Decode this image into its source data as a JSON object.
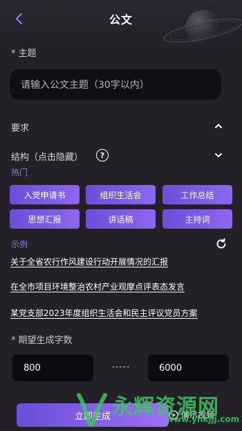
{
  "header": {
    "title": "公文"
  },
  "subject": {
    "label": "主题",
    "required_mark": "*",
    "placeholder": "请输入公文主题（30字以内）"
  },
  "requirements": {
    "label": "要求",
    "expanded": true
  },
  "structure": {
    "label": "结构（点击隐藏）",
    "help": "?"
  },
  "hot": {
    "label": "热门",
    "tags": [
      "入党申请书",
      "组织生活会",
      "工作总结",
      "思想汇报",
      "讲话稿",
      "主持词"
    ]
  },
  "examples": {
    "label": "示例",
    "items": [
      "关于全省农行作风建设行动开展情况的汇报",
      "在全市项目环境整治农村产业观摩点评表态发言",
      "某党支部2023年度组织生活会和民主评议党员方案"
    ]
  },
  "word_count": {
    "label": "期望生成字数",
    "required_mark": "*",
    "min": "800",
    "separator": "-----",
    "max": "6000"
  },
  "footer": {
    "generate_label": "立即生成",
    "demo_label": "演示视频"
  },
  "watermark": {
    "text": "永辉资源网",
    "url": "www.yhkjjj.com"
  },
  "colors": {
    "accent": "#7b5ce6",
    "background": "#232127",
    "link": "#8a7fd6"
  }
}
